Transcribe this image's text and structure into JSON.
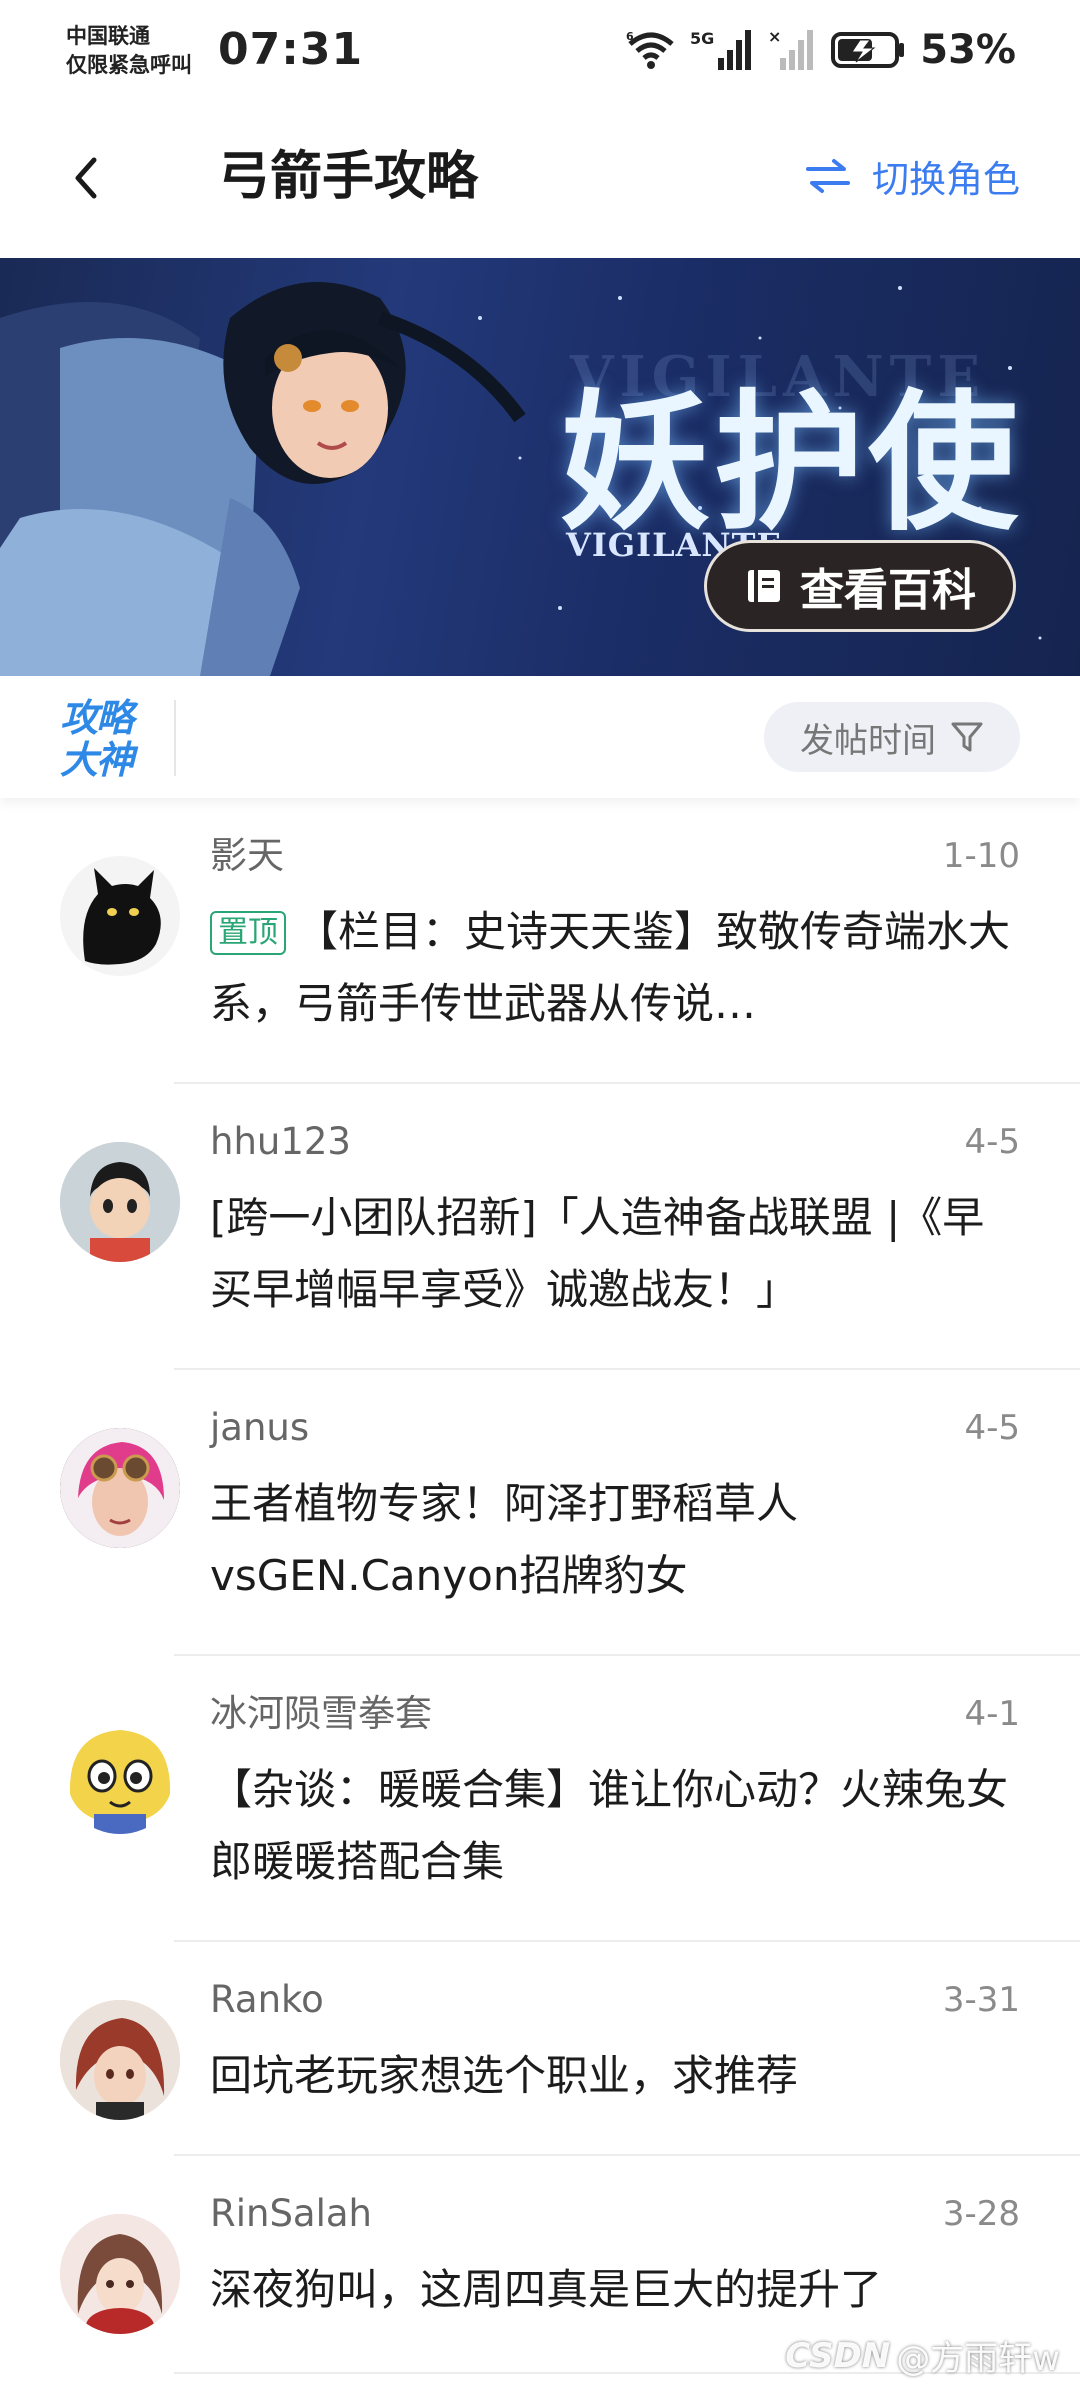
{
  "status_bar": {
    "carrier_line1": "中国联通",
    "carrier_line2": "仅限紧急呼叫",
    "time": "07:31",
    "network": "5G",
    "battery": "53%",
    "icons": [
      "wifi-icon",
      "signal-icon",
      "no-signal-icon",
      "battery-icon"
    ]
  },
  "header": {
    "title": "弓箭手攻略",
    "switch_label": "切换角色",
    "back_icon": "back-arrow-icon",
    "switch_icon": "swap-arrows-icon"
  },
  "banner": {
    "title": "妖护使",
    "subtitle": "VIGILANTE",
    "watermark": "VIGILANTE",
    "button_label": "查看百科",
    "button_icon": "book-icon"
  },
  "filter_bar": {
    "logo_line1": "攻略",
    "logo_line2": "大神",
    "sort_label": "发帖时间",
    "sort_icon": "filter-funnel-icon"
  },
  "posts": [
    {
      "author": "影天",
      "date": "1-10",
      "pinned": true,
      "pin_label": "置顶",
      "title": "【栏目：史诗天天鉴】致敬传奇端水大系，弓箭手传世武器从传说…"
    },
    {
      "author": "hhu123",
      "date": "4-5",
      "pinned": false,
      "title": "[跨一小团队招新]「人造神备战联盟 |《早买早增幅早享受》诚邀战友！」"
    },
    {
      "author": "janus",
      "date": "4-5",
      "pinned": false,
      "title": " 王者植物专家！阿泽打野稻草人vsGEN.Canyon招牌豹女"
    },
    {
      "author": "冰河陨雪拳套",
      "date": "4-1",
      "pinned": false,
      "title": "【杂谈：暖暖合集】谁让你心动？火辣兔女郎暖暖搭配合集"
    },
    {
      "author": "Ranko",
      "date": "3-31",
      "pinned": false,
      "title": " 回坑老玩家想选个职业，求推荐"
    },
    {
      "author": "RinSalah",
      "date": "3-28",
      "pinned": false,
      "title": " 深夜狗叫，这周四真是巨大的提升了"
    }
  ],
  "watermark": {
    "brand": "CSDN",
    "handle": "@方雨轩w"
  }
}
